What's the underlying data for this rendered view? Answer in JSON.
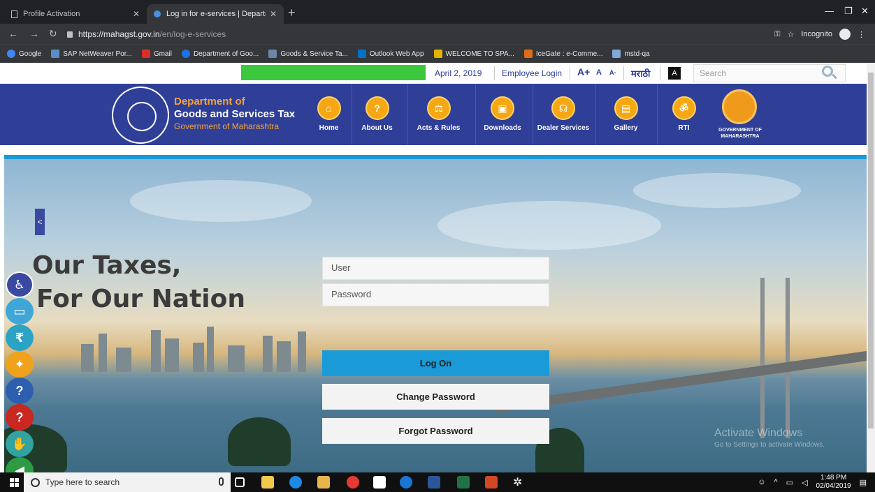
{
  "browser": {
    "tabs": [
      {
        "title": "Profile Activation"
      },
      {
        "title": "Log in for e-services | Departmen"
      }
    ],
    "new_tab": "+",
    "url_host": "https://mahagst.gov.in",
    "url_path": "/en/log-e-services",
    "profile_label": "Incognito",
    "bookmarks": [
      {
        "label": "Google",
        "color": "#4285f4"
      },
      {
        "label": "SAP NetWeaver Por...",
        "color": "#5b8cc6"
      },
      {
        "label": "Gmail",
        "color": "#d93025"
      },
      {
        "label": "Department of Goo...",
        "color": "#1a73e8"
      },
      {
        "label": "Goods & Service Ta...",
        "color": "#6b87a8"
      },
      {
        "label": "Outlook Web App",
        "color": "#0072c6"
      },
      {
        "label": "WELCOME TO SPA...",
        "color": "#e6b400"
      },
      {
        "label": "IceGate : e-Comme...",
        "color": "#e06c1a"
      },
      {
        "label": "mstd-qa",
        "color": "#7fa9d6"
      }
    ]
  },
  "topbar": {
    "date": "April 2, 2019",
    "employee_login": "Employee Login",
    "font_large": "A+",
    "font_normal": "A",
    "font_small": "A-",
    "language": "मराठी",
    "contrast": "A",
    "search_placeholder": "Search"
  },
  "header": {
    "dept_line1": "Department of",
    "dept_line2": "Goods and Services Tax",
    "dept_line3": "Government of Maharashtra",
    "nav": [
      {
        "label": "Home",
        "icon": "home-icon",
        "glyph": "⌂"
      },
      {
        "label": "About Us",
        "icon": "question-icon",
        "glyph": "?"
      },
      {
        "label": "Acts & Rules",
        "icon": "scales-icon",
        "glyph": "⚖"
      },
      {
        "label": "Downloads",
        "icon": "download-icon",
        "glyph": "▣"
      },
      {
        "label": "Dealer Services",
        "icon": "headset-icon",
        "glyph": "☊"
      },
      {
        "label": "Gallery",
        "icon": "gallery-icon",
        "glyph": "▤"
      },
      {
        "label": "RTI",
        "icon": "rti-icon",
        "glyph": "ॐ"
      }
    ],
    "gov_label": "GOVERNMENT OF MAHARASHTRA"
  },
  "hero": {
    "line1": "Our Taxes,",
    "line2": "For Our Nation"
  },
  "login": {
    "user_placeholder": "User",
    "password_placeholder": "Password",
    "logon": "Log On",
    "change_password": "Change Password",
    "forgot_password": "Forgot Password"
  },
  "watermark": {
    "line1": "Activate Windows",
    "line2": "Go to Settings to activate Windows."
  },
  "taskbar": {
    "search_placeholder": "Type here to search",
    "time": "1:48 PM",
    "date": "02/04/2019"
  },
  "colors": {
    "header_blue": "#2f3f98",
    "accent_orange": "#f5a23a",
    "logon_blue": "#1a9ad6"
  }
}
